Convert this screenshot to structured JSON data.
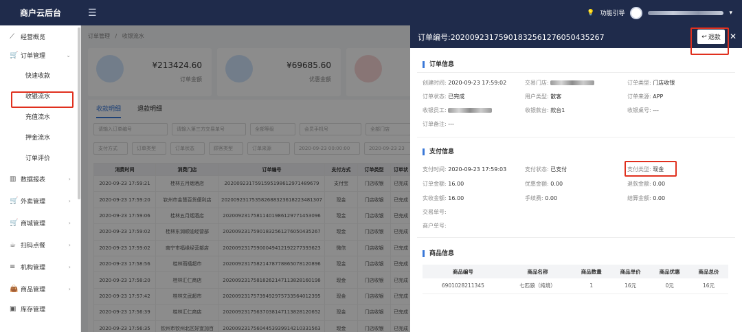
{
  "app": {
    "title": "商户云后台",
    "guide_label": "功能引导"
  },
  "sidebar": {
    "items": [
      {
        "label": "经营概览",
        "icon": "trend-icon"
      },
      {
        "label": "订单管理",
        "icon": "cart-icon",
        "expanded": true
      },
      {
        "label": "数据报表",
        "icon": "bar-chart-icon"
      },
      {
        "label": "外卖管理",
        "icon": "cart-icon"
      },
      {
        "label": "商城管理",
        "icon": "cart-icon"
      },
      {
        "label": "扫码点餐",
        "icon": "cup-icon"
      },
      {
        "label": "机构管理",
        "icon": "list-icon"
      },
      {
        "label": "商品管理",
        "icon": "bag-icon"
      },
      {
        "label": "库存管理",
        "icon": "box-icon"
      }
    ],
    "sub_items": [
      "快速收款",
      "收银流水",
      "充值流水",
      "押金流水",
      "订单评价"
    ]
  },
  "breadcrumb": {
    "root": "订单管理",
    "sep": "/",
    "current": "收银流水"
  },
  "summary": [
    {
      "amount": "¥213424.60",
      "label": "订单金额"
    },
    {
      "amount": "¥69685.60",
      "label": "优惠金额"
    }
  ],
  "tabs": [
    "收款明细",
    "退款明细"
  ],
  "filters": {
    "order_no": "请输入订单编号",
    "third_no": "请输入第三方交易单号",
    "level": "全部等级",
    "member_phone": "会员手机号",
    "store": "全部门店",
    "pay_method": "支付方式",
    "order_type": "订单类型",
    "order_status": "订单状态",
    "customer_type": "顾客类型",
    "order_source": "订单来源",
    "date_start": "2020-09-23 00:00:00",
    "date_end": "2020-09-23 23"
  },
  "table": {
    "headers": [
      "消费时间",
      "消费门店",
      "订单编号",
      "支付方式",
      "订单类型",
      "订单状"
    ],
    "rows": [
      [
        "2020-09-23 17:59:21",
        "桂林五月烟酒店",
        "202009231759159519861297148967​9",
        "支付宝",
        "门店收银",
        "已完成"
      ],
      [
        "2020-09-23 17:59:20",
        "钦州市金慧百货便利店",
        "20200923175358268832361822348130​7",
        "现金",
        "门店收银",
        "已完成"
      ],
      [
        "2020-09-23 17:59:06",
        "桂林五月烟酒店",
        "202009231758114019861297714530​96",
        "现金",
        "门店收银",
        "已完成"
      ],
      [
        "2020-09-23 17:59:02",
        "桂林东润顺油经营部",
        "20200923175901832561276050435​267",
        "现金",
        "门店收银",
        "已完成"
      ],
      [
        "2020-09-23 17:59:02",
        "南宁市福缘经营部店",
        "20200923175900049412192277393​623",
        "微信",
        "门店收银",
        "已完成"
      ],
      [
        "2020-09-23 17:58:56",
        "桂林雨禧超市",
        "20200923175821478778865078120​896",
        "现金",
        "门店收银",
        "已完成"
      ],
      [
        "2020-09-23 17:58:20",
        "桂林汇仁商店",
        "20200923175818262147113828160​198",
        "现金",
        "门店收银",
        "已完成"
      ],
      [
        "2020-09-23 17:57:42",
        "桂林文武超市",
        "20200923175739492975733564012​395",
        "现金",
        "门店收银",
        "已完成"
      ],
      [
        "2020-09-23 17:56:39",
        "桂林汇仁商店",
        "20200923175637038147113828120​652",
        "现金",
        "门店收银",
        "已完成"
      ],
      [
        "2020-09-23 17:56:35",
        "钦州市钦州北区好宜加百",
        "20200923175604453939914210331​563",
        "现金",
        "门店收银",
        "已完成"
      ]
    ]
  },
  "drawer": {
    "title_label": "订单编号:",
    "order_no": "20200923175901832561276050435267",
    "refund_label": "退款",
    "order_info_title": "订单信息",
    "order_info": {
      "create_time_k": "创建时间:",
      "create_time_v": "2020-09-23 17:59:02",
      "store_k": "交易门店:",
      "order_type_k": "订单类型:",
      "order_type_v": "门店收银",
      "status_k": "订单状态:",
      "status_v": "已完成",
      "user_type_k": "用户类型:",
      "user_type_v": "散客",
      "source_k": "订单来源:",
      "source_v": "APP",
      "cashier_k": "收银员工:",
      "register_k": "收银款台:",
      "register_v": "款台1",
      "table_k": "收银桌号:",
      "table_v": "---",
      "remark_k": "订单备注:",
      "remark_v": "---"
    },
    "pay_info_title": "支付信息",
    "pay_info": {
      "pay_time_k": "支付时间:",
      "pay_time_v": "2020-09-23 17:59:03",
      "pay_status_k": "支付状态:",
      "pay_status_v": "已支付",
      "pay_type_k": "支付类型:",
      "pay_type_v": "现金",
      "order_amount_k": "订单金额:",
      "order_amount_v": "16.00",
      "discount_k": "优惠金额:",
      "discount_v": "0.00",
      "refund_k": "退款金额:",
      "refund_v": "0.00",
      "received_k": "实收金额:",
      "received_v": "16.00",
      "fee_k": "手续费:",
      "fee_v": "0.00",
      "settle_k": "结算金额:",
      "settle_v": "0.00",
      "trade_no_k": "交易单号:",
      "merchant_no_k": "商户单号:"
    },
    "goods_title": "商品信息",
    "goods_headers": [
      "商品编号",
      "商品名称",
      "商品数量",
      "商品单价",
      "商品优惠",
      "商品总价"
    ],
    "goods_rows": [
      [
        "6901028211345",
        "七匹狼（纯境）",
        "1",
        "16元",
        "0元",
        "16元"
      ]
    ]
  },
  "watermark": "人数跨境",
  "colors": {
    "accent": "#3a78d8",
    "highlight": "#e0301e",
    "header": "#1f2b4b"
  }
}
